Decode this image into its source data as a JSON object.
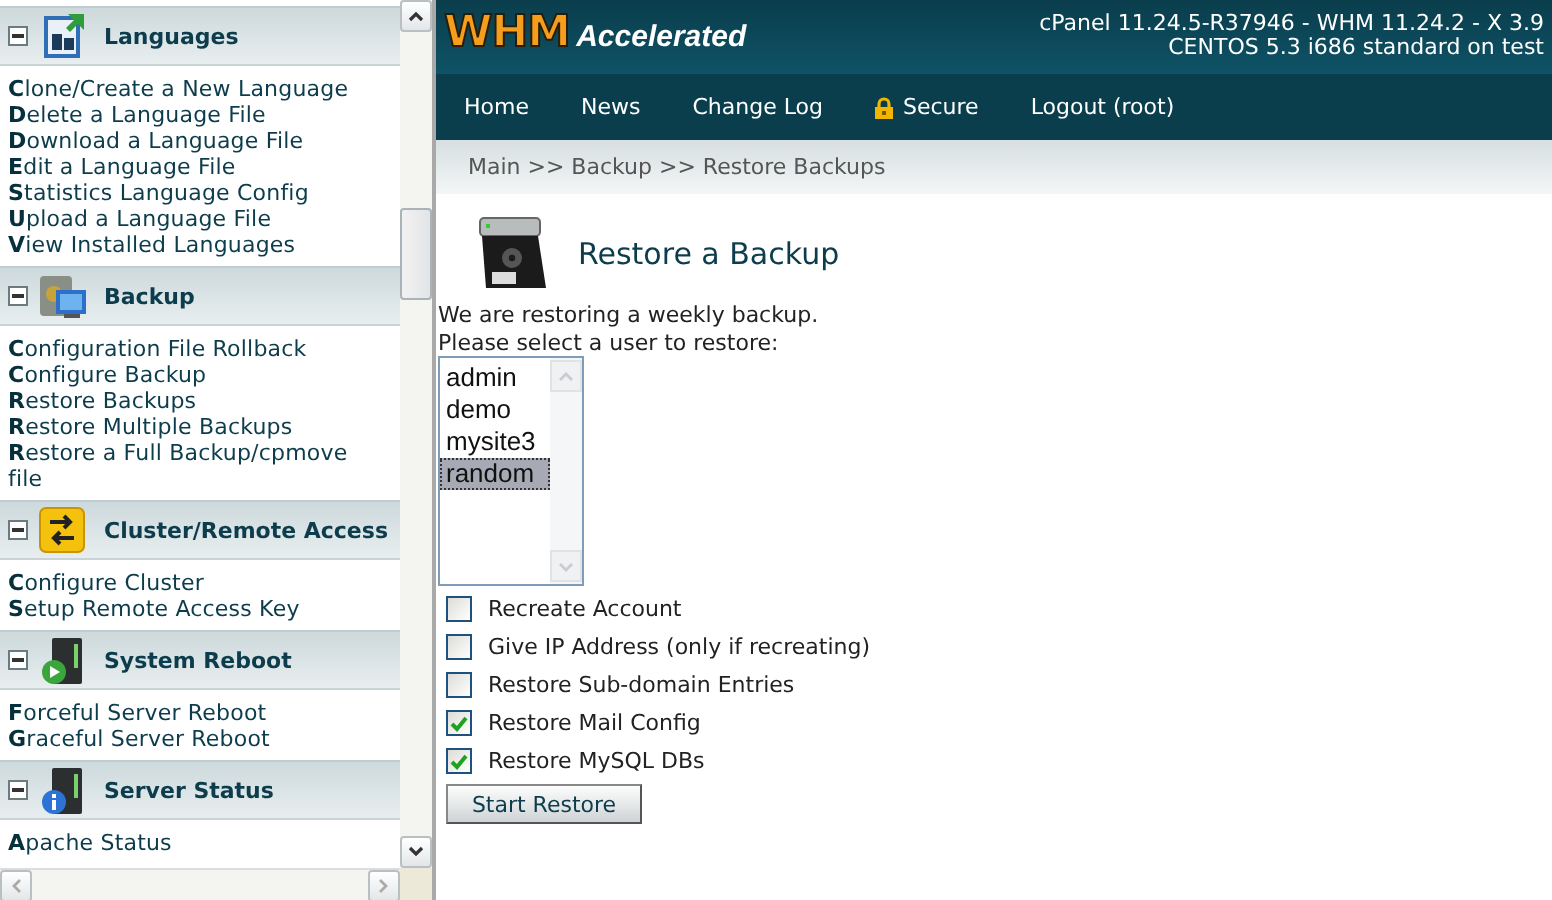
{
  "sidebar": {
    "sections": [
      {
        "title": "Languages",
        "expanded": true,
        "links": [
          "**C**lone/Create a New Language",
          "**D**elete a Language File",
          "**D**ownload a Language File",
          "**E**dit a Language File",
          "**S**tatistics Language Config",
          "**U**pload a Language File",
          "**V**iew Installed Languages"
        ]
      },
      {
        "title": "Backup",
        "expanded": true,
        "links": [
          "**C**onfiguration File Rollback",
          "**C**onfigure Backup",
          "**R**estore Backups",
          "**R**estore Multiple Backups",
          "**R**estore a Full Backup/cpmove file"
        ]
      },
      {
        "title": "Cluster/Remote Access",
        "expanded": true,
        "links": [
          "**C**onfigure Cluster",
          "**S**etup Remote Access Key"
        ]
      },
      {
        "title": "System Reboot",
        "expanded": true,
        "links": [
          "**F**orceful Server Reboot",
          "**G**raceful Server Reboot"
        ]
      },
      {
        "title": "Server Status",
        "expanded": true,
        "links": [
          "**A**pache Status"
        ]
      }
    ]
  },
  "header": {
    "logo_main": "WHM",
    "logo_sub": "Accelerated",
    "version_lines": [
      "cPanel 11.24.5-R37946 - WHM 11.24.2 - X 3.9",
      "CENTOS 5.3 i686 standard on test"
    ]
  },
  "nav": [
    {
      "label": "Home",
      "lock": false
    },
    {
      "label": "News",
      "lock": false
    },
    {
      "label": "Change Log",
      "lock": false
    },
    {
      "label": "Secure",
      "lock": true
    },
    {
      "label": "Logout (root)",
      "lock": false
    }
  ],
  "breadcrumb": "Main >> Backup >> Restore Backups",
  "content": {
    "title": "Restore a Backup",
    "intro": [
      "We are restoring a weekly backup.",
      "Please select a user to restore:"
    ],
    "users": [
      {
        "label": "admin",
        "selected": false
      },
      {
        "label": "demo",
        "selected": false
      },
      {
        "label": "mysite3",
        "selected": false
      },
      {
        "label": "random",
        "selected": true
      }
    ],
    "options": [
      {
        "label": "Recreate Account",
        "checked": false
      },
      {
        "label": "Give IP Address (only if recreating)",
        "checked": false
      },
      {
        "label": "Restore Sub-domain Entries",
        "checked": false
      },
      {
        "label": "Restore Mail Config",
        "checked": true
      },
      {
        "label": "Restore MySQL DBs",
        "checked": true
      }
    ],
    "button": "Start Restore"
  }
}
